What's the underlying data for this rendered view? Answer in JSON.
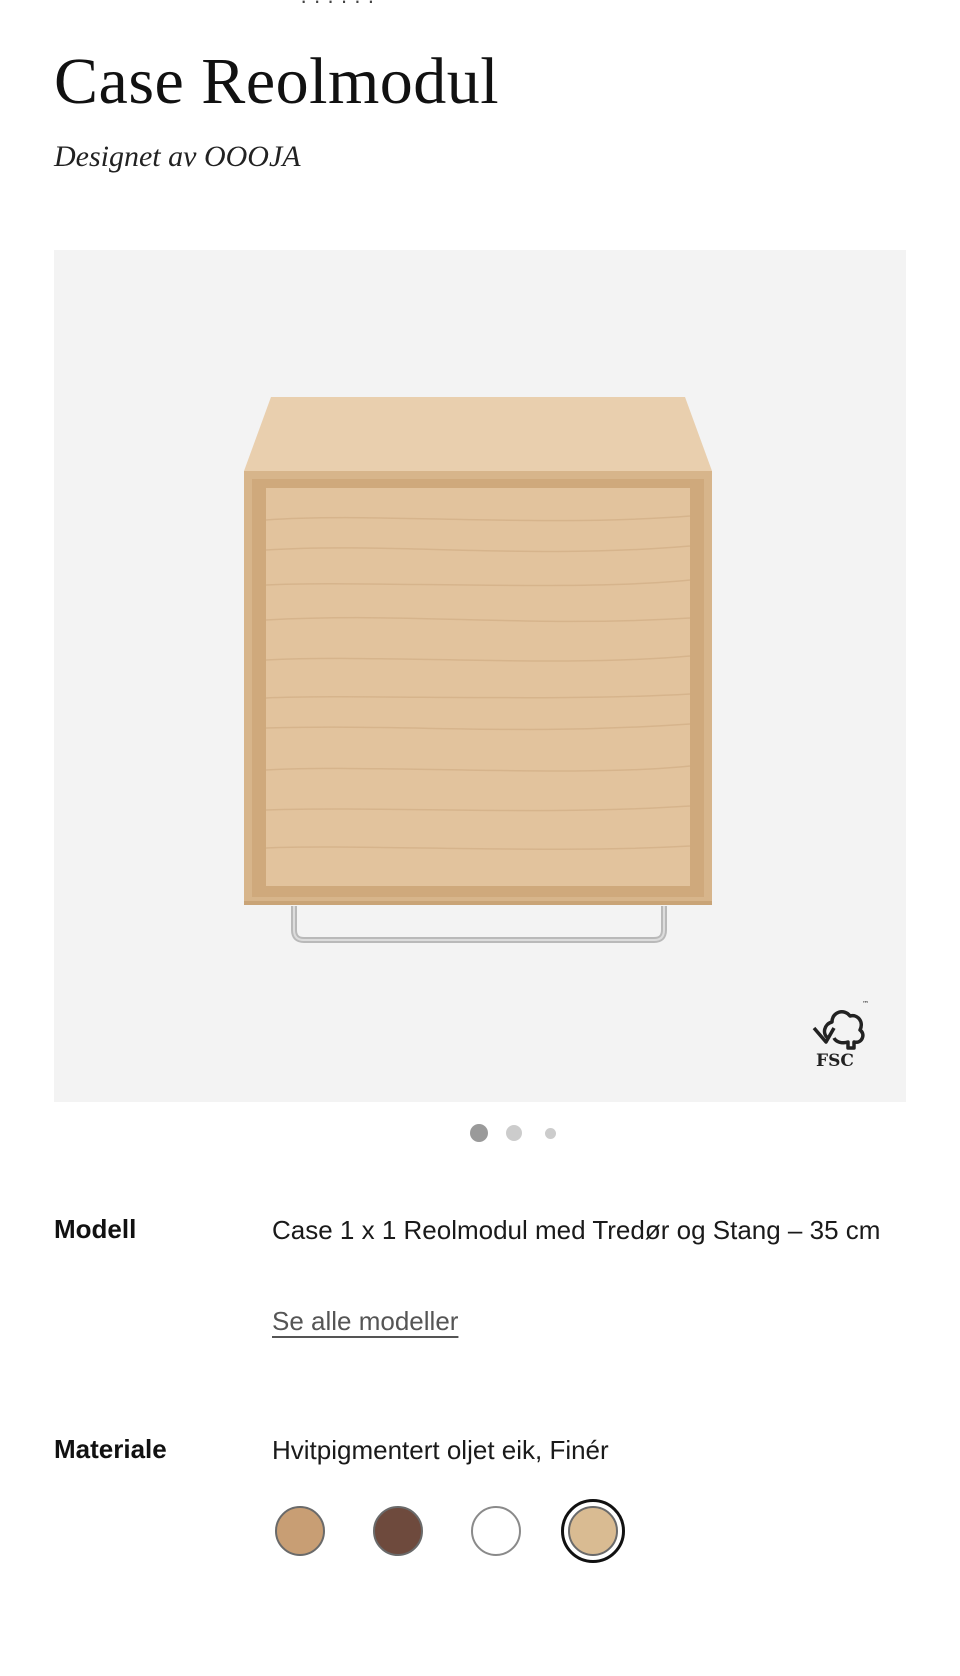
{
  "product": {
    "title": "Case Reolmodul",
    "designer": "Designet av OOOJA"
  },
  "top_partial_text": "· · · · · ·",
  "gallery": {
    "badge_text": "FSC",
    "dots_count": 3,
    "active_index": 0,
    "image_colors": {
      "background": "#f3f3f3",
      "wood_front": "#e2c39d",
      "wood_top": "#e9cfae",
      "wood_edge": "#d7b58b",
      "rail": "#b9b9b9"
    }
  },
  "specs": {
    "model_label": "Modell",
    "model_value": "Case 1 x 1 Reolmodul med Tredør og Stang – 35 cm",
    "see_all_link": "Se alle modeller",
    "material_label": "Materiale",
    "material_value": "Hvitpigmentert oljet eik, Finér"
  },
  "swatches": [
    {
      "color": "#c89e74",
      "name": "oak"
    },
    {
      "color": "#6e4a3d",
      "name": "walnut"
    },
    {
      "color": "#ffffff",
      "name": "white"
    },
    {
      "color": "#d9bb92",
      "name": "white-pigmented-oak"
    }
  ],
  "selected_swatch": 3
}
